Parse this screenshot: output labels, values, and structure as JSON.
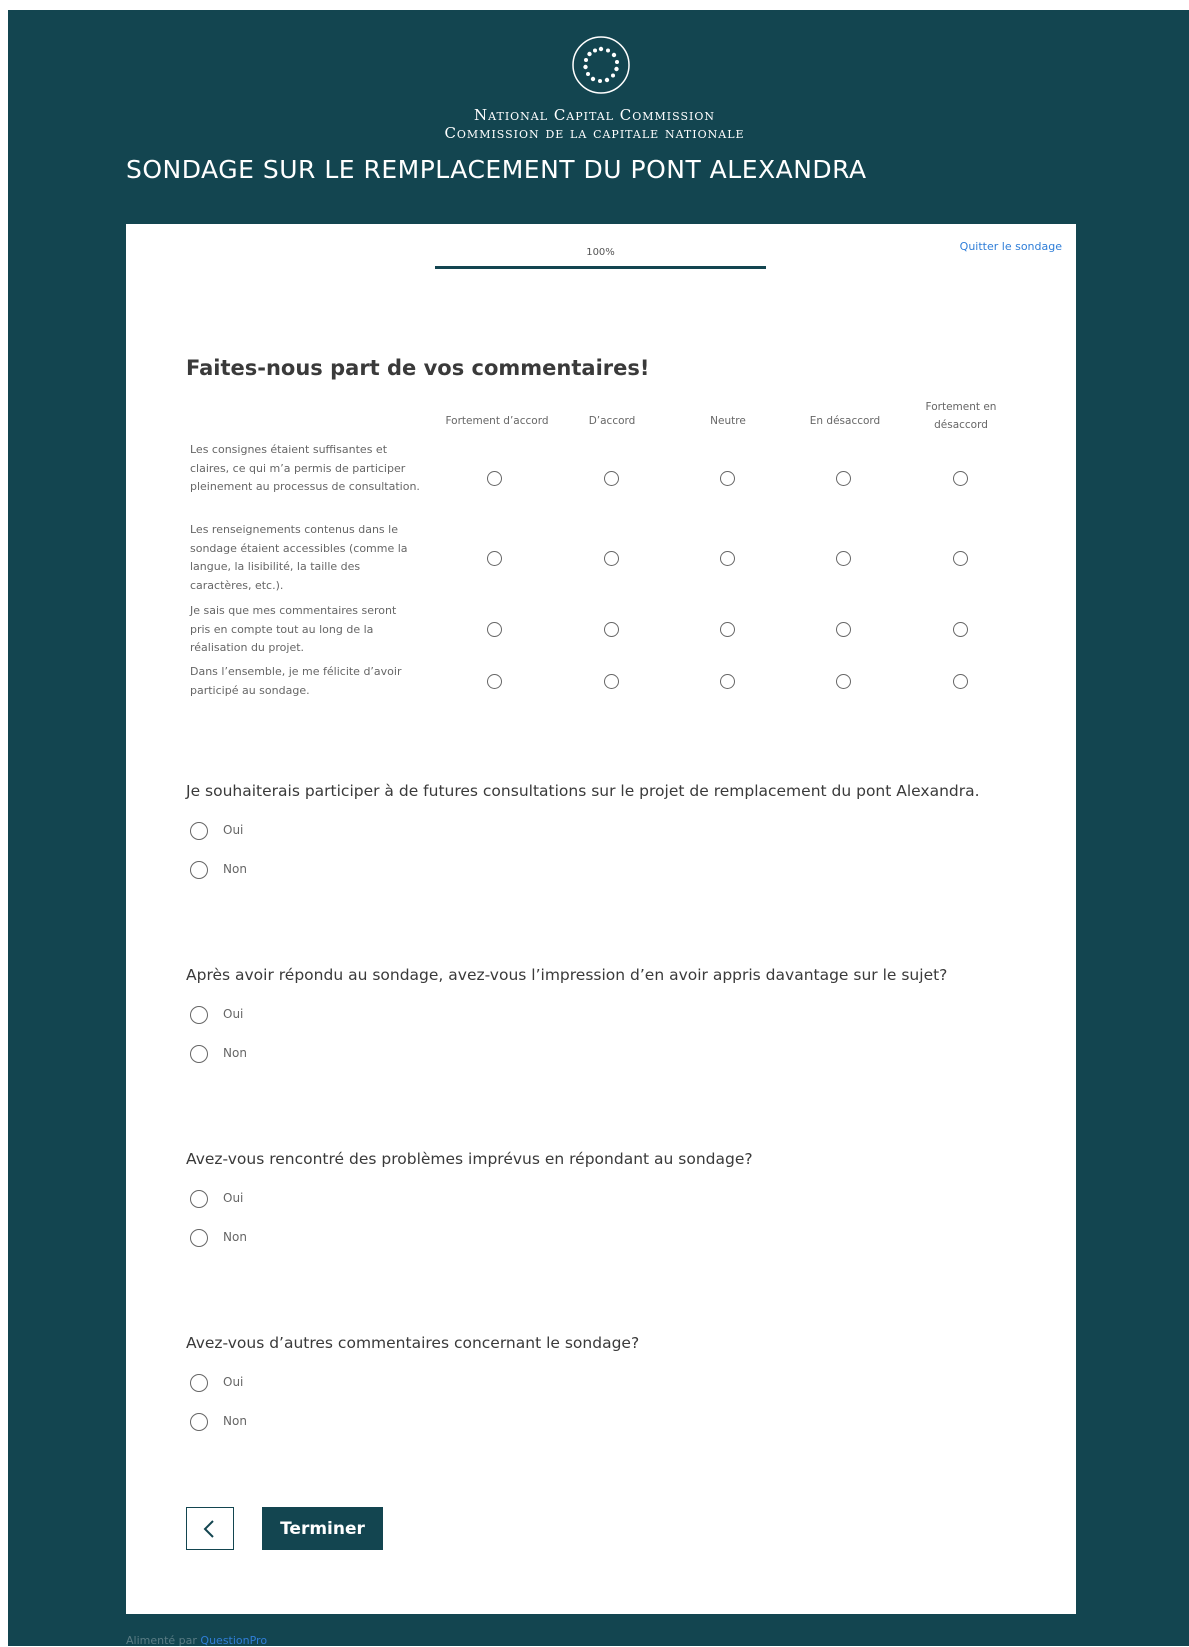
{
  "header": {
    "org_en": "National Capital Commission",
    "org_fr": "Commission de la capitale nationale",
    "survey_title": "SONDAGE SUR LE REMPLACEMENT DU PONT ALEXANDRA",
    "logo_icon": "ncc-ring-logo-icon"
  },
  "progress": {
    "label": "100%",
    "value": 1.0
  },
  "quit_link": "Quitter le sondage",
  "matrix": {
    "title": "Faites-nous part de vos commentaires!",
    "columns": [
      "Fortement d’accord",
      "D’accord",
      "Neutre",
      "En désaccord",
      "Fortement en désaccord"
    ],
    "rows": [
      "Les consignes étaient suffisantes et claires, ce qui m’a permis de participer pleinement au processus de consultation.",
      "Les renseignements contenus dans le sondage étaient accessibles (comme la langue, la lisibilité, la taille des caractères, etc.).",
      "Je sais que mes commentaires seront pris en compte tout au long de la réalisation du projet.",
      "Dans l’ensemble, je me félicite d’avoir participé au sondage."
    ]
  },
  "questions": [
    {
      "title": "Je souhaiterais participer à de futures consultations sur le projet de remplacement du pont Alexandra.",
      "options": [
        "Oui",
        "Non"
      ]
    },
    {
      "title": "Après avoir répondu au sondage, avez-vous l’impression d’en avoir appris davantage sur le sujet?",
      "options": [
        "Oui",
        "Non"
      ]
    },
    {
      "title": "Avez-vous rencontré des problèmes imprévus en répondant au sondage?",
      "options": [
        "Oui",
        "Non"
      ]
    },
    {
      "title": "Avez-vous d’autres commentaires concernant le sondage?",
      "options": [
        "Oui",
        "Non"
      ]
    }
  ],
  "buttons": {
    "back_icon": "chevron-left-icon",
    "finish_label": "Terminer"
  },
  "footer": {
    "powered_prefix": "Alimenté par ",
    "powered_brand": "QuestionPro"
  },
  "colors": {
    "brand": "#134550",
    "link": "#2f7ed8"
  }
}
